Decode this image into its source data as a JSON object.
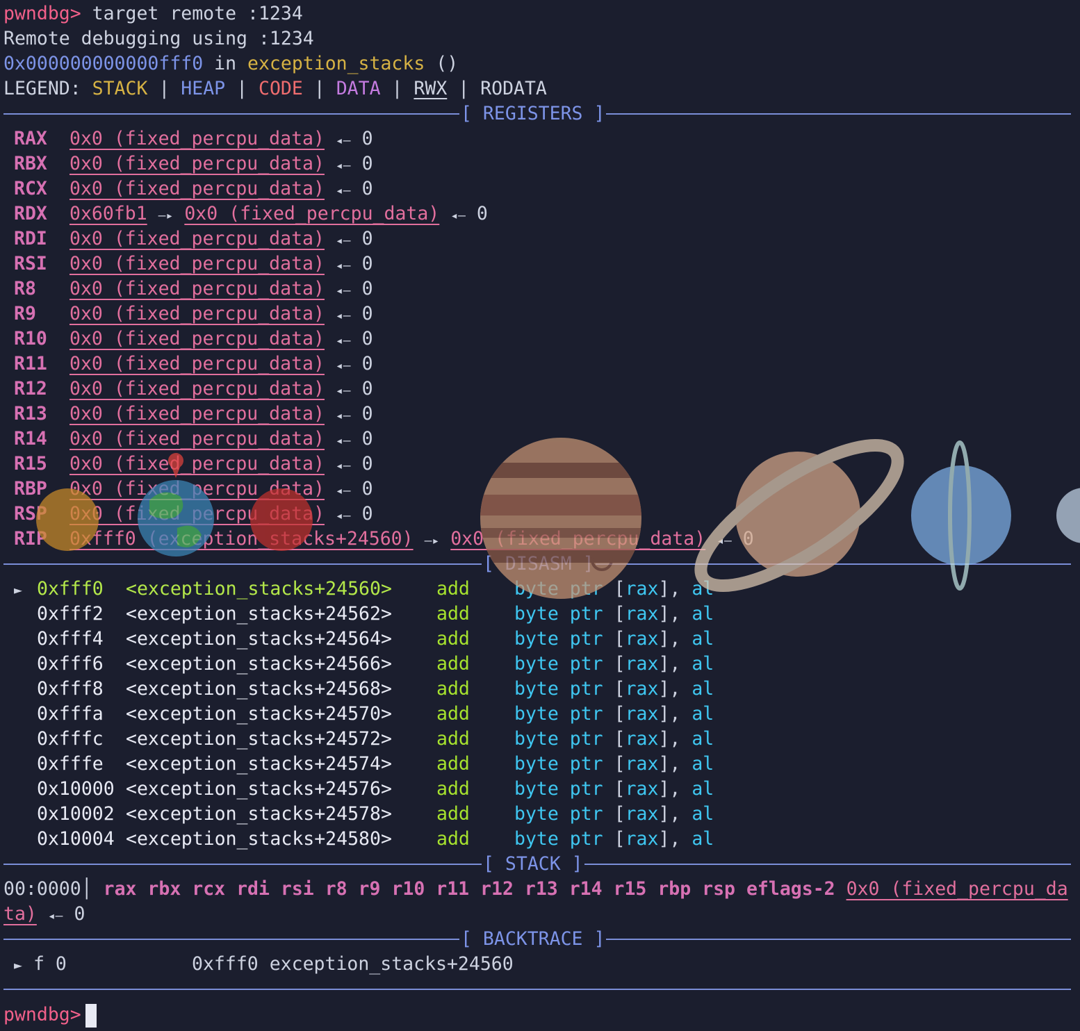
{
  "header": {
    "prompt": "pwndbg>",
    "command": " target remote :1234",
    "remote_msg": "Remote debugging using :1234",
    "frame_addr": "0x000000000000fff0",
    "frame_in": " in ",
    "frame_func": "exception_stacks",
    "frame_args": " ()"
  },
  "legend": {
    "label": "LEGEND: ",
    "stack": "STACK",
    "heap": "HEAP",
    "code": "CODE",
    "data": "DATA",
    "rwx": "RWX",
    "rodata": "RODATA",
    "sep": " | "
  },
  "sections": {
    "registers": "[ REGISTERS ]",
    "disasm": "[ DISASM ]",
    "stack": "[ STACK ]",
    "backtrace": "[ BACKTRACE ]"
  },
  "registers": [
    {
      "name": "RAX",
      "value": "0x0 (fixed_percpu_data)",
      "deref": "0"
    },
    {
      "name": "RBX",
      "value": "0x0 (fixed_percpu_data)",
      "deref": "0"
    },
    {
      "name": "RCX",
      "value": "0x0 (fixed_percpu_data)",
      "deref": "0"
    },
    {
      "name": "RDX",
      "value": "0x60fb1",
      "mid": "0x0 (fixed_percpu_data)",
      "deref": "0"
    },
    {
      "name": "RDI",
      "value": "0x0 (fixed_percpu_data)",
      "deref": "0"
    },
    {
      "name": "RSI",
      "value": "0x0 (fixed_percpu_data)",
      "deref": "0"
    },
    {
      "name": "R8",
      "value": "0x0 (fixed_percpu_data)",
      "deref": "0"
    },
    {
      "name": "R9",
      "value": "0x0 (fixed_percpu_data)",
      "deref": "0"
    },
    {
      "name": "R10",
      "value": "0x0 (fixed_percpu_data)",
      "deref": "0"
    },
    {
      "name": "R11",
      "value": "0x0 (fixed_percpu_data)",
      "deref": "0"
    },
    {
      "name": "R12",
      "value": "0x0 (fixed_percpu_data)",
      "deref": "0"
    },
    {
      "name": "R13",
      "value": "0x0 (fixed_percpu_data)",
      "deref": "0"
    },
    {
      "name": "R14",
      "value": "0x0 (fixed_percpu_data)",
      "deref": "0"
    },
    {
      "name": "R15",
      "value": "0x0 (fixed_percpu_data)",
      "deref": "0"
    },
    {
      "name": "RBP",
      "value": "0x0 (fixed_percpu_data)",
      "deref": "0"
    },
    {
      "name": "RSP",
      "value": "0x0 (fixed_percpu_data)",
      "deref": "0"
    },
    {
      "name": "RIP",
      "value": "0xfff0 (exception_stacks+24560)",
      "mid": "0x0 (fixed_percpu_data)",
      "deref": "0"
    }
  ],
  "arrows": {
    "deref": "◂—",
    "ptr": "—▸"
  },
  "disasm": [
    {
      "marker": "►",
      "addr": "0xfff0",
      "sym": "<exception_stacks+24560>",
      "mnem": "add",
      "op1": "byte ptr",
      "br1": "[",
      "reg": "rax",
      "br2": "],",
      "op2": "al"
    },
    {
      "marker": "",
      "addr": "0xfff2",
      "sym": "<exception_stacks+24562>",
      "mnem": "add",
      "op1": "byte ptr",
      "br1": "[",
      "reg": "rax",
      "br2": "],",
      "op2": "al"
    },
    {
      "marker": "",
      "addr": "0xfff4",
      "sym": "<exception_stacks+24564>",
      "mnem": "add",
      "op1": "byte ptr",
      "br1": "[",
      "reg": "rax",
      "br2": "],",
      "op2": "al"
    },
    {
      "marker": "",
      "addr": "0xfff6",
      "sym": "<exception_stacks+24566>",
      "mnem": "add",
      "op1": "byte ptr",
      "br1": "[",
      "reg": "rax",
      "br2": "],",
      "op2": "al"
    },
    {
      "marker": "",
      "addr": "0xfff8",
      "sym": "<exception_stacks+24568>",
      "mnem": "add",
      "op1": "byte ptr",
      "br1": "[",
      "reg": "rax",
      "br2": "],",
      "op2": "al"
    },
    {
      "marker": "",
      "addr": "0xfffa",
      "sym": "<exception_stacks+24570>",
      "mnem": "add",
      "op1": "byte ptr",
      "br1": "[",
      "reg": "rax",
      "br2": "],",
      "op2": "al"
    },
    {
      "marker": "",
      "addr": "0xfffc",
      "sym": "<exception_stacks+24572>",
      "mnem": "add",
      "op1": "byte ptr",
      "br1": "[",
      "reg": "rax",
      "br2": "],",
      "op2": "al"
    },
    {
      "marker": "",
      "addr": "0xfffe",
      "sym": "<exception_stacks+24574>",
      "mnem": "add",
      "op1": "byte ptr",
      "br1": "[",
      "reg": "rax",
      "br2": "],",
      "op2": "al"
    },
    {
      "marker": "",
      "addr": "0x10000",
      "sym": "<exception_stacks+24576>",
      "mnem": "add",
      "op1": "byte ptr",
      "br1": "[",
      "reg": "rax",
      "br2": "],",
      "op2": "al"
    },
    {
      "marker": "",
      "addr": "0x10002",
      "sym": "<exception_stacks+24578>",
      "mnem": "add",
      "op1": "byte ptr",
      "br1": "[",
      "reg": "rax",
      "br2": "],",
      "op2": "al"
    },
    {
      "marker": "",
      "addr": "0x10004",
      "sym": "<exception_stacks+24580>",
      "mnem": "add",
      "op1": "byte ptr",
      "br1": "[",
      "reg": "rax",
      "br2": "],",
      "op2": "al"
    }
  ],
  "stack": {
    "offset": "00:0000",
    "bar": "│",
    "regs": " rax rbx rcx rdi rsi r8 r9 r10 r11 r12 r13 r14 r15 rbp rsp eflags-2 ",
    "value_part1": "0x0 (fixed_percpu_da",
    "value_part2": "ta)",
    "deref": "0"
  },
  "backtrace": {
    "marker": "►",
    "frame": "f 0",
    "addr": "0xfff0",
    "sym": "exception_stacks+24560"
  },
  "prompt_final": "pwndbg>",
  "colors": {
    "background": "#1b1e2e",
    "prompt": "#f2608a",
    "address_blue": "#7d94e8",
    "code_yellow": "#d6b244",
    "register": "#d771b3",
    "mnemonic": "#a6e22e",
    "operand": "#3fc7f1",
    "rule": "#7b8ed8"
  }
}
